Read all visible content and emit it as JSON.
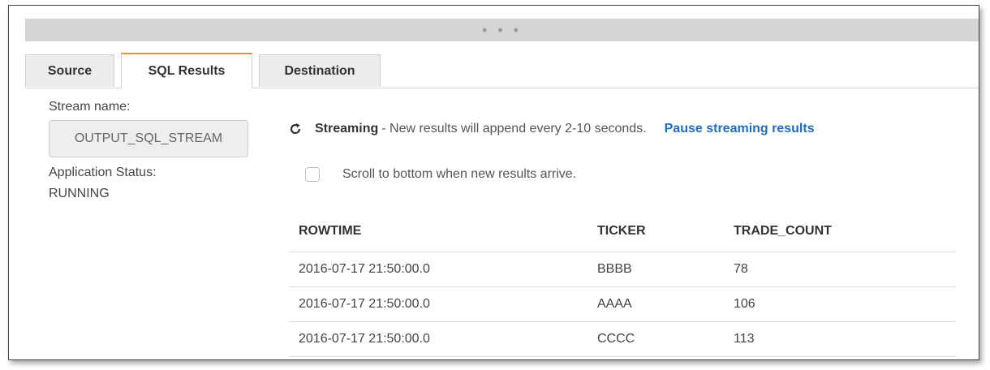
{
  "handle": {
    "dots": "• • •"
  },
  "tabs": [
    {
      "label": "Source",
      "active": false
    },
    {
      "label": "SQL Results",
      "active": true
    },
    {
      "label": "Destination",
      "active": false
    }
  ],
  "sidebar": {
    "stream_name_label": "Stream name:",
    "stream_name_value": "OUTPUT_SQL_STREAM",
    "app_status_label": "Application Status:",
    "app_status_value": "RUNNING"
  },
  "streaming": {
    "icon": "refresh-icon",
    "title": "Streaming",
    "description": "- New results will append every 2-10 seconds.",
    "pause_link": "Pause streaming results"
  },
  "scroll_option": {
    "label": "Scroll to bottom when new results arrive.",
    "checked": false
  },
  "table": {
    "headers": [
      "ROWTIME",
      "TICKER",
      "TRADE_COUNT"
    ],
    "rows": [
      [
        "2016-07-17 21:50:00.0",
        "BBBB",
        "78"
      ],
      [
        "2016-07-17 21:50:00.0",
        "AAAA",
        "106"
      ],
      [
        "2016-07-17 21:50:00.0",
        "CCCC",
        "113"
      ]
    ]
  },
  "colors": {
    "accent_tab": "#e7912f",
    "link": "#1a6fc1",
    "handle_bar": "#d6d6d6"
  }
}
